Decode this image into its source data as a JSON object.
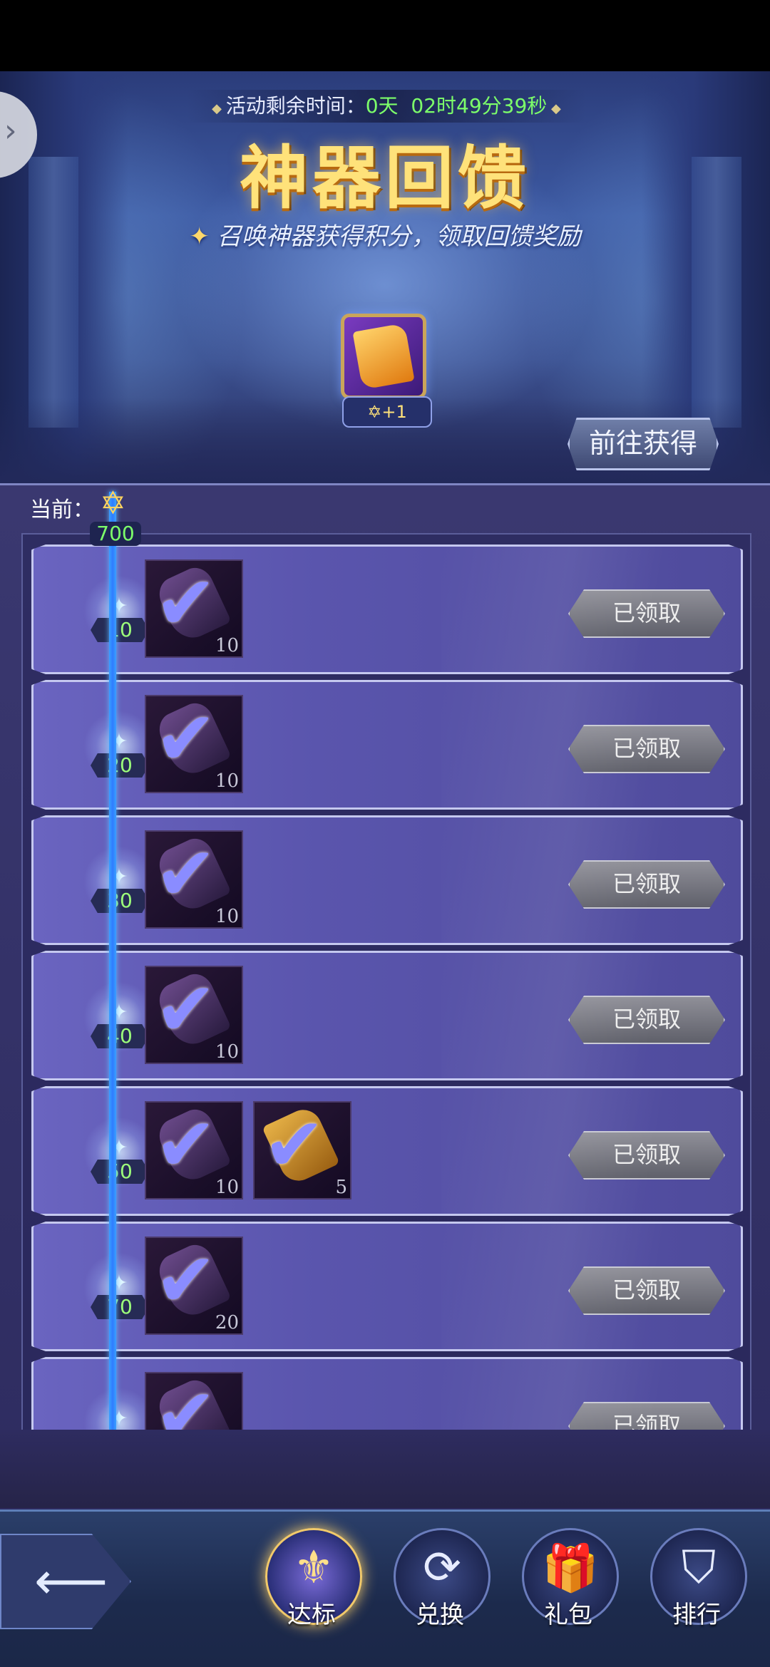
{
  "banner": {
    "timer_label": "活动剩余时间：",
    "timer_days": "0天",
    "timer_time": "02时49分39秒",
    "title": "神器回馈",
    "subtitle": "召唤神器获得积分，领取回馈奖励",
    "reward_badge": "+1",
    "goto_button": "前往获得"
  },
  "progress": {
    "current_label": "当前：",
    "current_points": "700"
  },
  "tiers": [
    {
      "points": "10",
      "items": [
        {
          "qty": "10",
          "kind": "gem"
        }
      ],
      "status": "已领取"
    },
    {
      "points": "20",
      "items": [
        {
          "qty": "10",
          "kind": "gem"
        }
      ],
      "status": "已领取"
    },
    {
      "points": "30",
      "items": [
        {
          "qty": "10",
          "kind": "gem"
        }
      ],
      "status": "已领取"
    },
    {
      "points": "40",
      "items": [
        {
          "qty": "10",
          "kind": "gem"
        }
      ],
      "status": "已领取"
    },
    {
      "points": "50",
      "items": [
        {
          "qty": "10",
          "kind": "gem"
        },
        {
          "qty": "5",
          "kind": "scroll"
        }
      ],
      "status": "已领取"
    },
    {
      "points": "70",
      "items": [
        {
          "qty": "20",
          "kind": "gem"
        }
      ],
      "status": "已领取"
    },
    {
      "points": "",
      "items": [
        {
          "qty": "",
          "kind": "gem"
        }
      ],
      "status": "已领取"
    }
  ],
  "nav": {
    "tabs": [
      {
        "label": "达标",
        "icon": "wings-emblem-icon",
        "active": true
      },
      {
        "label": "兑换",
        "icon": "exchange-icon",
        "active": false
      },
      {
        "label": "礼包",
        "icon": "gift-icon",
        "active": false
      },
      {
        "label": "排行",
        "icon": "rank-badge-icon",
        "active": false
      }
    ]
  },
  "colors": {
    "accent_gold": "#ffe27a",
    "timer_green": "#7dff6a",
    "progress_blue": "#2f7cff",
    "panel_purple": "#5a55ad",
    "claimed_gray": "#8f8f98"
  }
}
